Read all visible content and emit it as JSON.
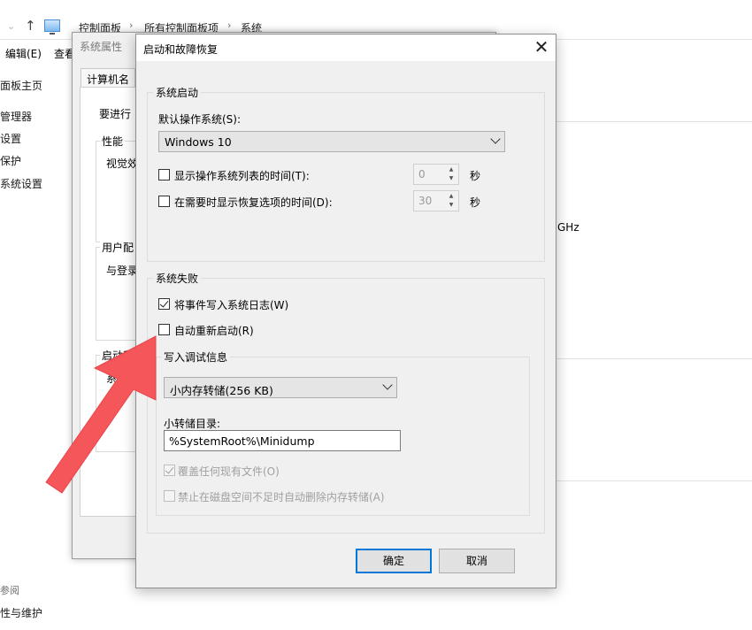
{
  "explorer": {
    "breadcrumb": [
      "控制面板",
      "所有控制面板项",
      "系统"
    ],
    "menu": [
      "编辑(E)",
      "查看"
    ],
    "left_items": [
      "面板主页",
      "管理器",
      "设置",
      "保护",
      "系统设置"
    ],
    "left_bottom": [
      "参阅",
      "性与维护"
    ],
    "ghz_fragment": "GHz"
  },
  "system_properties": {
    "title": "系统属性",
    "tab": "计算机名",
    "text_frag": "要进行",
    "perf_group": "性能",
    "perf_text": "视觉效",
    "profile_group": "用户配",
    "profile_text": "与登录",
    "startup_group": "启动和",
    "startup_text": "系统启"
  },
  "dialog": {
    "title": "启动和故障恢复",
    "close_glyph": "✕",
    "startup_group": {
      "title": "系统启动",
      "default_os_label": "默认操作系统(S):",
      "default_os_value": "Windows 10",
      "show_list_label": "显示操作系统列表的时间(T):",
      "show_list_checked": false,
      "show_list_value": "0",
      "show_recovery_label": "在需要时显示恢复选项的时间(D):",
      "show_recovery_checked": false,
      "show_recovery_value": "30",
      "seconds_unit": "秒"
    },
    "failure_group": {
      "title": "系统失败",
      "write_event_label": "将事件写入系统日志(W)",
      "write_event_checked": true,
      "auto_restart_label": "自动重新启动(R)",
      "auto_restart_checked": false,
      "debug_group": {
        "title": "写入调试信息",
        "dump_type": "小内存转储(256 KB)",
        "dump_dir_label": "小转储目录:",
        "dump_dir_value": "%SystemRoot%\\Minidump",
        "overwrite_label": "覆盖任何现有文件(O)",
        "overwrite_checked": true,
        "disable_auto_delete_label": "禁止在磁盘空间不足时自动删除内存转储(A)",
        "disable_auto_delete_checked": false
      }
    },
    "ok_label": "确定",
    "cancel_label": "取消"
  },
  "annotation": {
    "arrow_color": "#f4565a"
  }
}
